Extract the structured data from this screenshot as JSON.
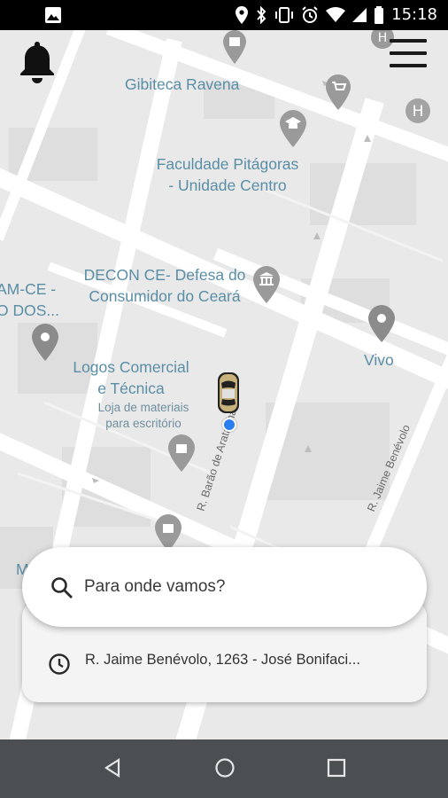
{
  "status_bar": {
    "time": "15:18"
  },
  "map": {
    "labels": {
      "gibiteca": "Gibiteca Ravena",
      "faculdade_line1": "Faculdade Pitágoras",
      "faculdade_line2": "- Unidade Centro",
      "decon_line1": "DECON CE- Defesa do",
      "decon_line2": "Consumidor do Ceará",
      "am_ce_line1": "AM-CE -",
      "am_ce_line2": "O DOS...",
      "logos_line1": "Logos Comercial",
      "logos_line2": "e Técnica",
      "logos_sub1": "Loja de materiais",
      "logos_sub2": "para escritório",
      "vivo": "Vivo",
      "barao": "R. Barão de Aratanha",
      "jaime": "R. Jaime Benévolo",
      "partial_m": "M"
    }
  },
  "search": {
    "placeholder": "Para onde vamos?",
    "recent": "R. Jaime Benévolo, 1263 - José Bonifaci..."
  },
  "colors": {
    "map_bg": "#e9e9e9",
    "road": "#ffffff",
    "poi_label": "#5a8ea6",
    "poi_pin": "#888888",
    "location_dot": "#2a7ff0",
    "nav_bar": "#4b4f52"
  }
}
